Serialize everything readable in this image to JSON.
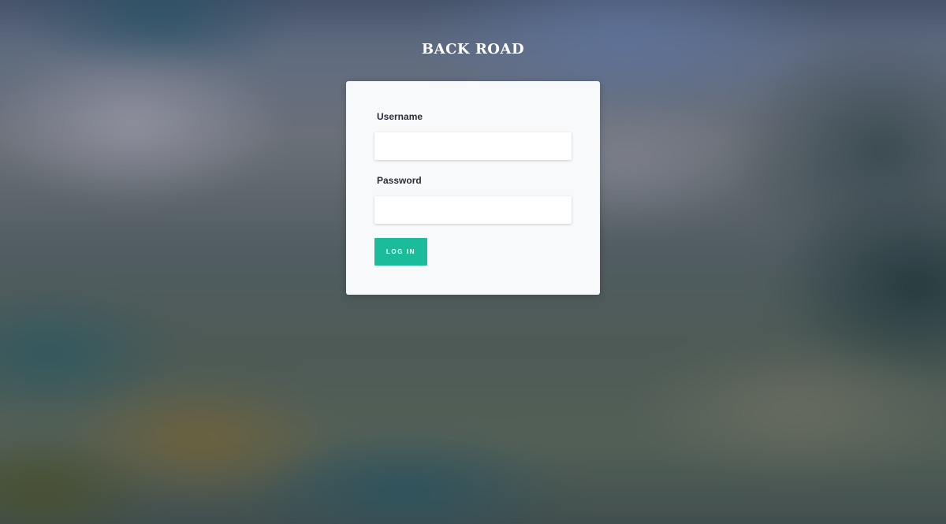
{
  "brand": {
    "title": "BACK ROAD"
  },
  "login_form": {
    "username_label": "Username",
    "username_value": "",
    "password_label": "Password",
    "password_value": "",
    "submit_label": "LOG IN"
  },
  "colors": {
    "accent": "#1abc9c",
    "card_background": "#f7f9fb",
    "brand_text": "#ffffff"
  }
}
